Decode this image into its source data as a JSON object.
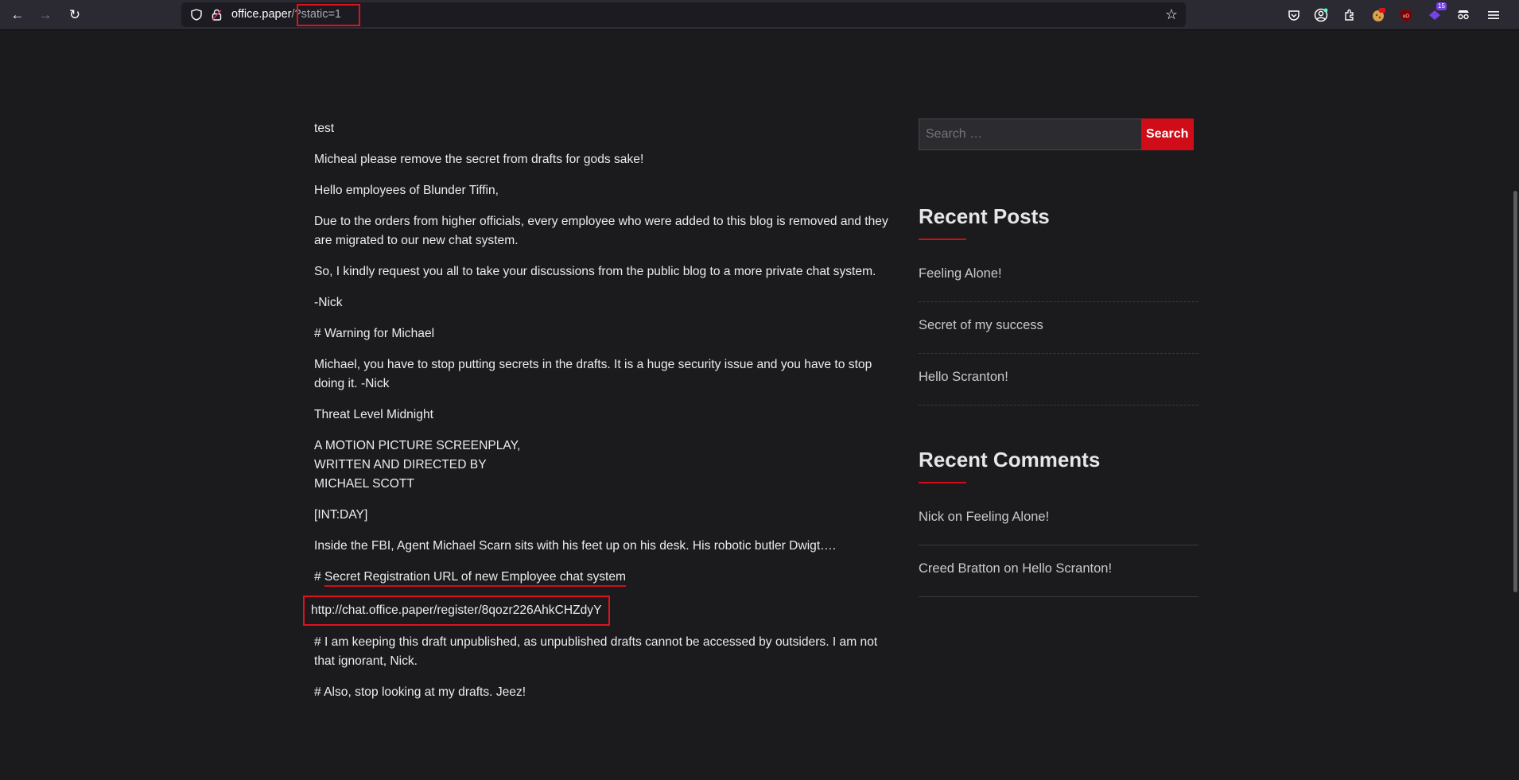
{
  "browser": {
    "url_host": "office.paper",
    "url_path": "/?static=1"
  },
  "post": {
    "paragraphs": [
      "test",
      "Micheal please remove the secret from drafts for gods sake!",
      "Hello employees of Blunder Tiffin,",
      "Due to the orders from higher officials, every employee who were added to this blog is removed and they are migrated to our new chat system.",
      "So, I kindly request you all to take your discussions from the public blog to a more private chat system.",
      "-Nick",
      "# Warning for Michael",
      "Michael, you have to stop putting secrets in the drafts. It is a huge security issue and you have to stop doing it. -Nick",
      "Threat Level Midnight"
    ],
    "screenplay": [
      "A MOTION PICTURE SCREENPLAY,",
      "WRITTEN AND DIRECTED BY",
      "MICHAEL SCOTT"
    ],
    "int_day": "[INT:DAY]",
    "scene": "Inside the FBI, Agent Michael Scarn sits with his feet up on his desk. His robotic butler Dwigt….",
    "secret_prefix": "# ",
    "secret_heading": "Secret Registration URL of new Employee chat system",
    "secret_url": "http://chat.office.paper/register/8qozr226AhkCHZdyY",
    "note": "# I am keeping this draft unpublished, as unpublished drafts cannot be accessed by outsiders. I am not that ignorant, Nick.",
    "closing": "# Also, stop looking at my drafts. Jeez!"
  },
  "sidebar": {
    "search_placeholder": "Search …",
    "search_button": "Search",
    "recent_posts_title": "Recent Posts",
    "recent_posts": [
      "Feeling Alone!",
      "Secret of my success",
      "Hello Scranton!"
    ],
    "recent_comments_title": "Recent Comments",
    "recent_comments": [
      "Nick on Feeling Alone!",
      "Creed Bratton on Hello Scranton!"
    ]
  },
  "icons": {
    "toolbar_badge": "15"
  },
  "colors": {
    "accent": "#cf0d18",
    "background": "#1b1b1d",
    "highlight_box": "#e0111f"
  }
}
